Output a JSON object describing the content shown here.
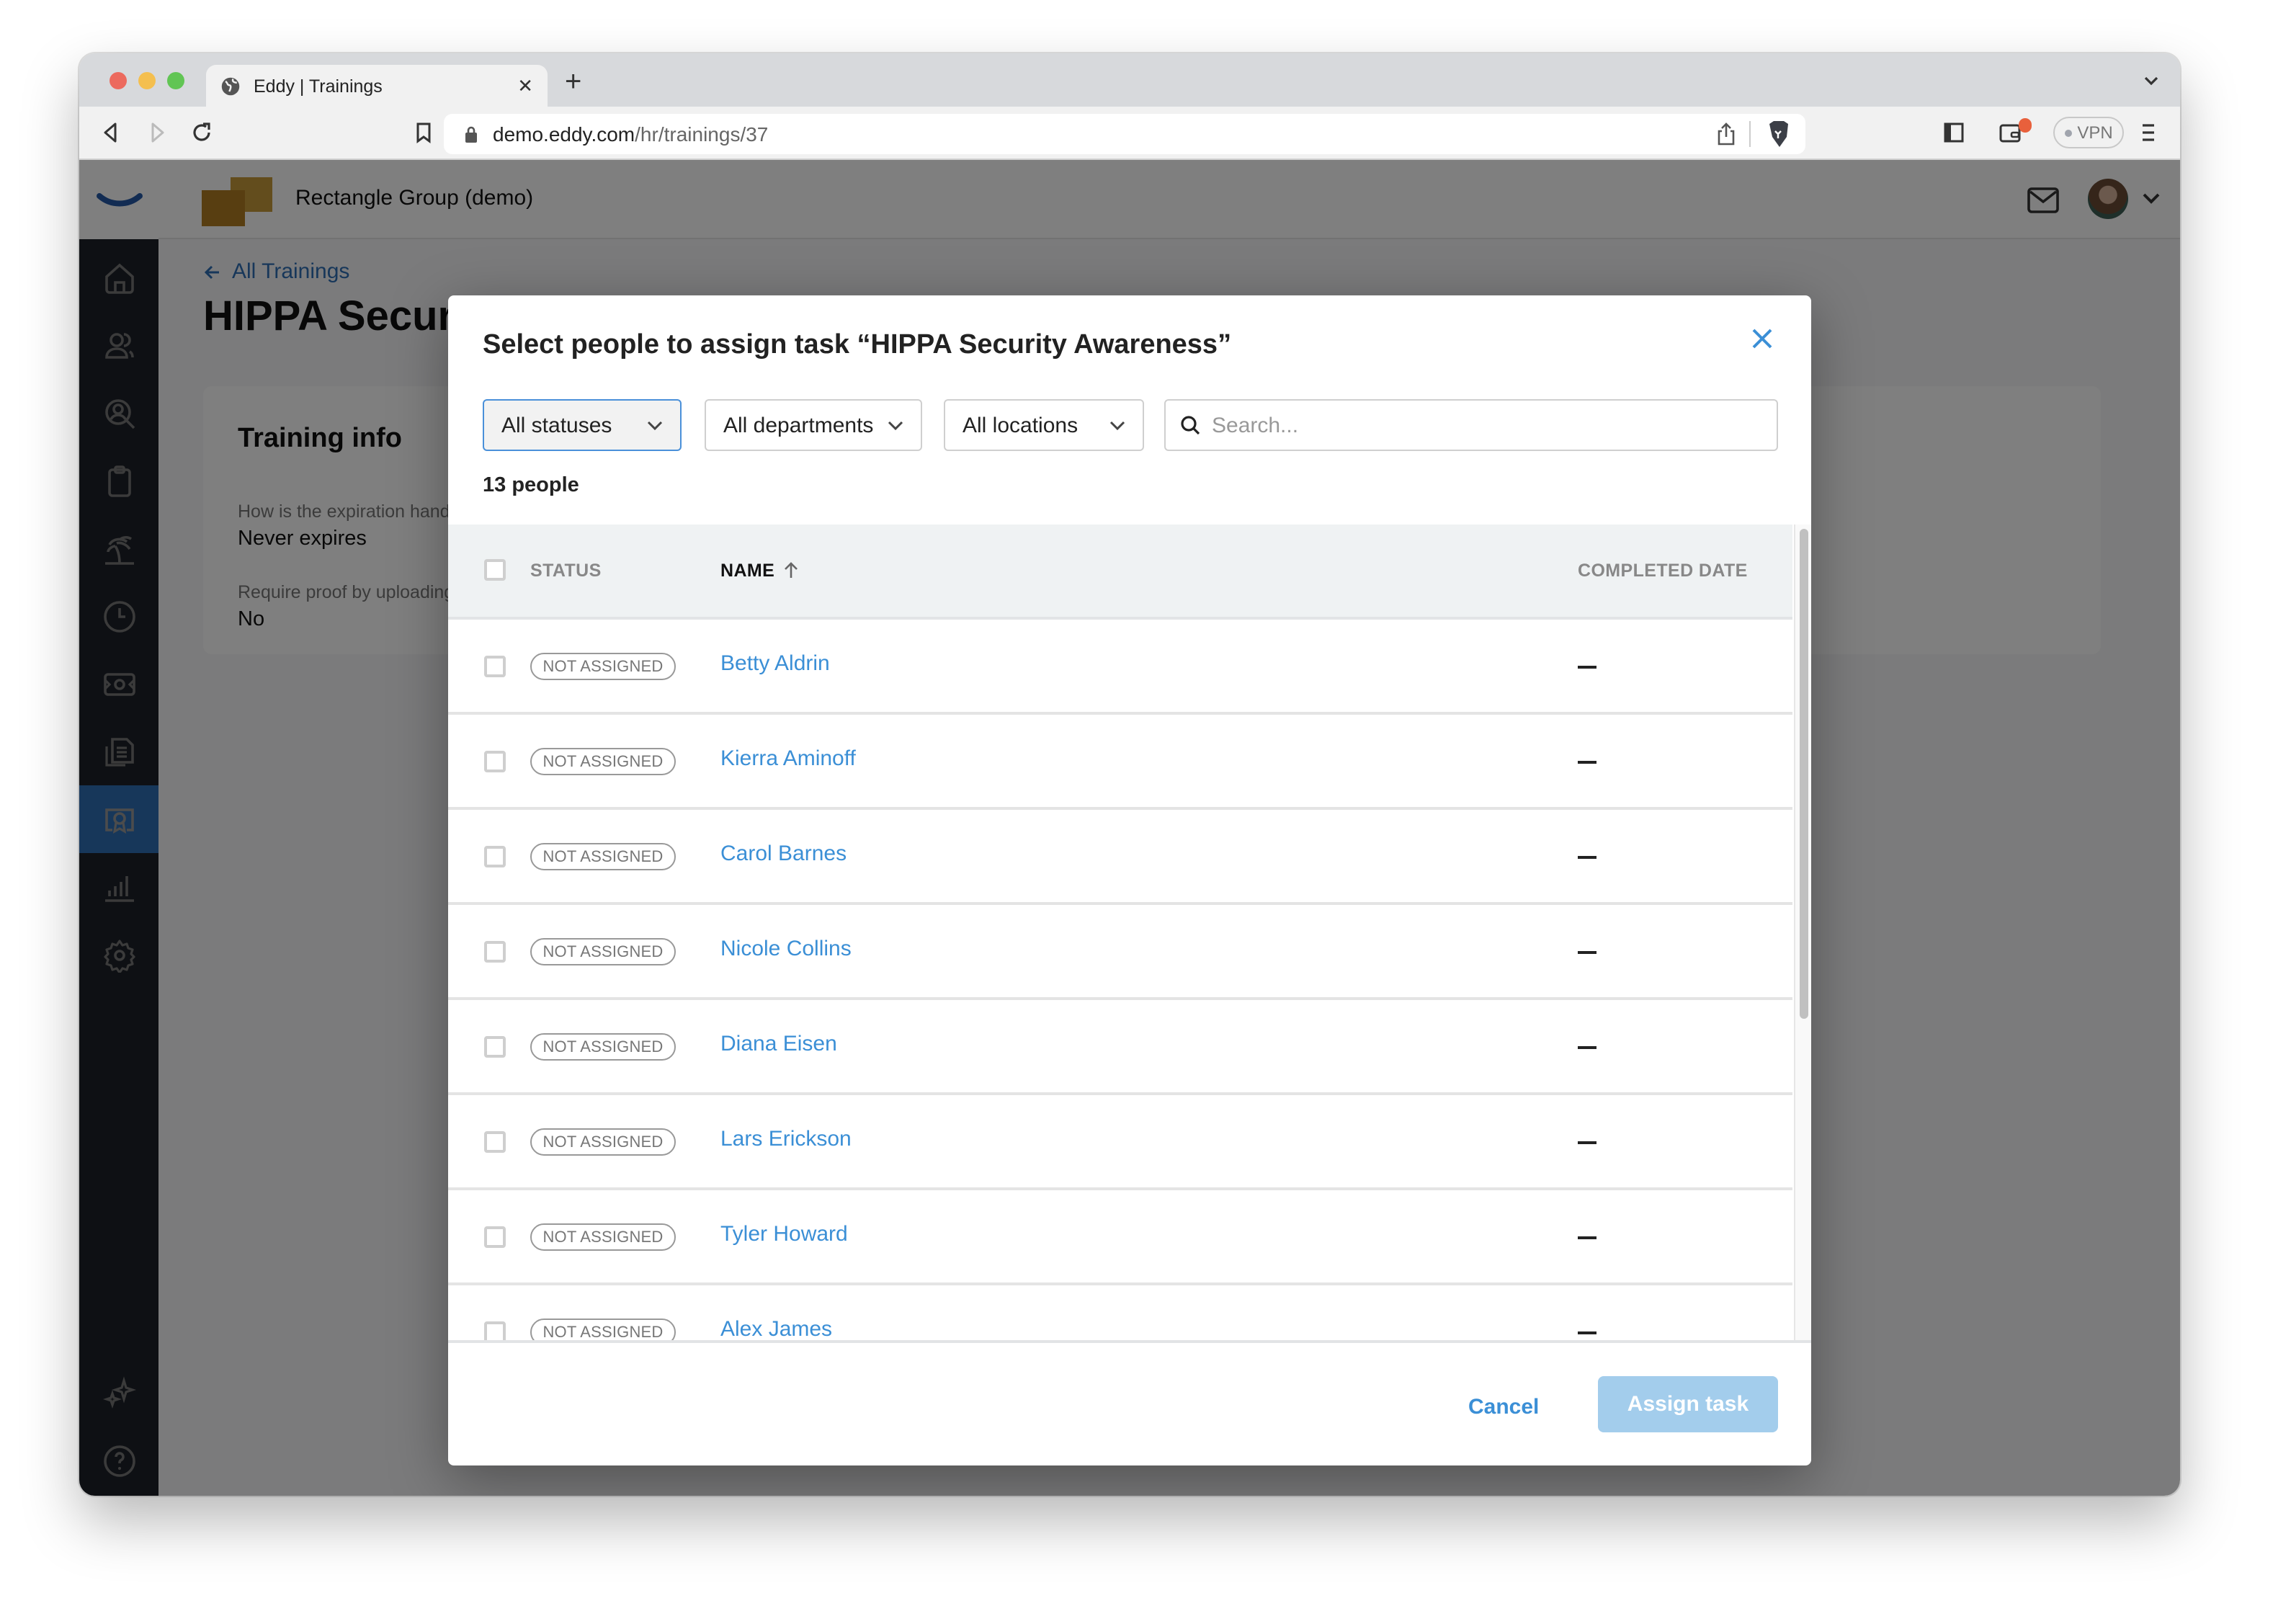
{
  "browser": {
    "tab_title": "Eddy | Trainings",
    "url_domain": "demo.eddy.com",
    "url_path": "/hr/trainings/37",
    "vpn_label": "VPN"
  },
  "app": {
    "company_name": "Rectangle Group (demo)",
    "sidebar": {
      "items": [
        {
          "name": "home",
          "icon": "home-icon"
        },
        {
          "name": "people",
          "icon": "people-icon"
        },
        {
          "name": "recruiting",
          "icon": "person-search-icon"
        },
        {
          "name": "tasks",
          "icon": "clipboard-icon"
        },
        {
          "name": "time-off",
          "icon": "palm-tree-icon"
        },
        {
          "name": "time-tracking",
          "icon": "clock-icon"
        },
        {
          "name": "payroll",
          "icon": "money-icon"
        },
        {
          "name": "documents",
          "icon": "documents-icon"
        },
        {
          "name": "trainings",
          "icon": "certificate-icon",
          "active": true
        },
        {
          "name": "reports",
          "icon": "bar-chart-icon"
        },
        {
          "name": "settings",
          "icon": "gear-icon"
        },
        {
          "name": "whats-new",
          "icon": "sparkles-icon"
        },
        {
          "name": "help",
          "icon": "help-icon"
        }
      ]
    }
  },
  "page": {
    "back_link": "All Trainings",
    "title": "HIPPA Security Awareness",
    "info_card": {
      "heading": "Training info",
      "fields": [
        {
          "label": "How is the expiration handled?",
          "value": "Never expires"
        },
        {
          "label": "Require proof by uploading a file?",
          "value": "No"
        }
      ]
    }
  },
  "modal": {
    "title": "Select people to assign task “HIPPA Security Awareness”",
    "filters": {
      "status": "All statuses",
      "department": "All departments",
      "location": "All locations"
    },
    "search": {
      "placeholder": "Search...",
      "value": ""
    },
    "count_label": "13 people",
    "columns": {
      "status": "STATUS",
      "name": "NAME",
      "completed_date": "COMPLETED DATE"
    },
    "sort": {
      "column": "name",
      "direction": "ascending"
    },
    "rows": [
      {
        "status": "NOT ASSIGNED",
        "name": "Betty Aldrin",
        "completed_date": "—"
      },
      {
        "status": "NOT ASSIGNED",
        "name": "Kierra Aminoff",
        "completed_date": "—"
      },
      {
        "status": "NOT ASSIGNED",
        "name": "Carol Barnes",
        "completed_date": "—"
      },
      {
        "status": "NOT ASSIGNED",
        "name": "Nicole Collins",
        "completed_date": "—"
      },
      {
        "status": "NOT ASSIGNED",
        "name": "Diana Eisen",
        "completed_date": "—"
      },
      {
        "status": "NOT ASSIGNED",
        "name": "Lars Erickson",
        "completed_date": "—"
      },
      {
        "status": "NOT ASSIGNED",
        "name": "Tyler Howard",
        "completed_date": "—"
      },
      {
        "status": "NOT ASSIGNED",
        "name": "Alex James",
        "completed_date": "—"
      }
    ],
    "cancel_label": "Cancel",
    "assign_label": "Assign task",
    "assign_disabled": true
  },
  "colors": {
    "accent": "#3b8fd6",
    "sidebar_bg": "#1c2028",
    "sidebar_active": "#2f6eb5",
    "assign_disabled": "#a3cdec"
  }
}
